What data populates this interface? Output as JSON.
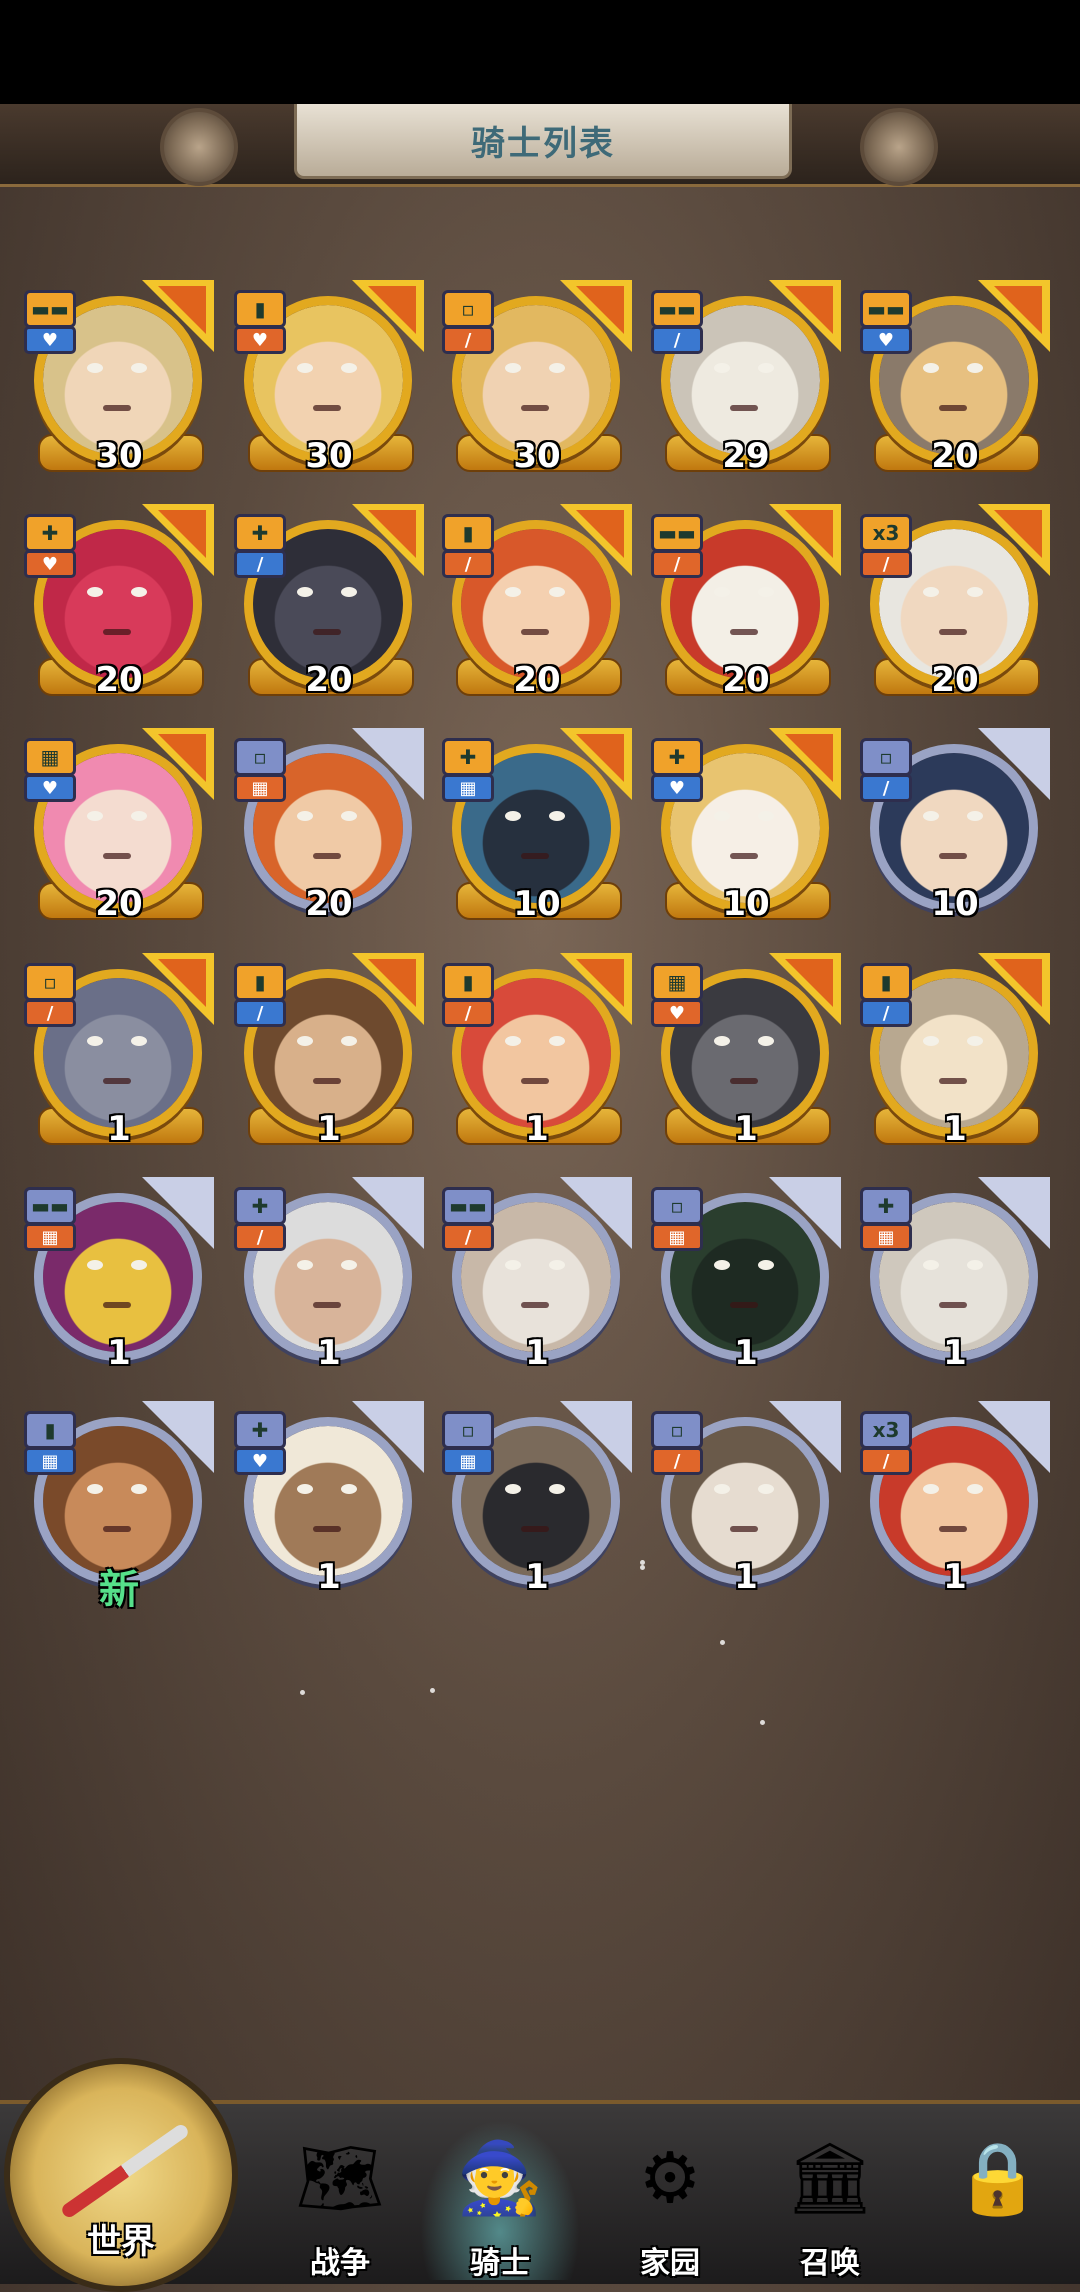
{
  "header": {
    "title": "骑士列表"
  },
  "heroes": [
    {
      "level": "30",
      "frame": "gold",
      "top": "▬▬",
      "bottom": "♥",
      "topColor": "#f0a22a",
      "bottomColor": "#3a78d0",
      "skin": "#f0d6b8",
      "hair": "#d8c28a"
    },
    {
      "level": "30",
      "frame": "gold",
      "top": "▮",
      "bottom": "♥",
      "topColor": "#f0a22a",
      "bottomColor": "#e0662a",
      "skin": "#f2d2b0",
      "hair": "#e8c460"
    },
    {
      "level": "30",
      "frame": "gold",
      "top": "▫",
      "bottom": "/",
      "topColor": "#f0a22a",
      "bottomColor": "#e0662a",
      "skin": "#f0d2b2",
      "hair": "#e2b860"
    },
    {
      "level": "29",
      "frame": "gold",
      "top": "▬▬",
      "bottom": "/",
      "topColor": "#f0a22a",
      "bottomColor": "#3a78d0",
      "skin": "#eeeae0",
      "hair": "#cbc4b8"
    },
    {
      "level": "20",
      "frame": "gold",
      "top": "▬▬",
      "bottom": "♥",
      "topColor": "#f0a22a",
      "bottomColor": "#3a78d0",
      "skin": "#e7c080",
      "hair": "#8a7a6a"
    },
    {
      "level": "20",
      "frame": "gold",
      "top": "✚",
      "bottom": "♥",
      "topColor": "#f0a22a",
      "bottomColor": "#e0662a",
      "skin": "#d83a5a",
      "hair": "#c02848"
    },
    {
      "level": "20",
      "frame": "gold",
      "top": "✚",
      "bottom": "/",
      "topColor": "#f0a22a",
      "bottomColor": "#3a78d0",
      "skin": "#4a4a58",
      "hair": "#2e2e38"
    },
    {
      "level": "20",
      "frame": "gold",
      "top": "▮",
      "bottom": "/",
      "topColor": "#f0a22a",
      "bottomColor": "#e0662a",
      "skin": "#f4d0b0",
      "hair": "#d8582a"
    },
    {
      "level": "20",
      "frame": "gold",
      "top": "▬▬",
      "bottom": "/",
      "topColor": "#f0a22a",
      "bottomColor": "#e0662a",
      "skin": "#f3efe6",
      "hair": "#c83a2a"
    },
    {
      "level": "20",
      "frame": "gold",
      "top": "x3",
      "bottom": "/",
      "topColor": "#f0a22a",
      "bottomColor": "#e0662a",
      "skin": "#f0d8c0",
      "hair": "#e8e6e0"
    },
    {
      "level": "20",
      "frame": "gold",
      "top": "▦",
      "bottom": "♥",
      "topColor": "#f0a22a",
      "bottomColor": "#3a78d0",
      "skin": "#f4dcd0",
      "hair": "#f08ab0"
    },
    {
      "level": "20",
      "frame": "silver",
      "top": "▫",
      "bottom": "▦",
      "topColor": "#7f8fc8",
      "bottomColor": "#e0662a",
      "skin": "#f0caa6",
      "hair": "#d8642a"
    },
    {
      "level": "10",
      "frame": "gold",
      "top": "✚",
      "bottom": "▦",
      "topColor": "#f0a22a",
      "bottomColor": "#3a78d0",
      "skin": "#26303e",
      "hair": "#3a6a8a"
    },
    {
      "level": "10",
      "frame": "gold",
      "top": "✚",
      "bottom": "♥",
      "topColor": "#f0a22a",
      "bottomColor": "#3a78d0",
      "skin": "#f6efe6",
      "hair": "#e8c470"
    },
    {
      "level": "10",
      "frame": "silver",
      "top": "▫",
      "bottom": "/",
      "topColor": "#7f8fc8",
      "bottomColor": "#3a78d0",
      "skin": "#f0d8c0",
      "hair": "#2c3a5a"
    },
    {
      "level": "1",
      "frame": "gold",
      "top": "▫",
      "bottom": "/",
      "topColor": "#f0a22a",
      "bottomColor": "#e0662a",
      "skin": "#8a8ea0",
      "hair": "#6a6f88"
    },
    {
      "level": "1",
      "frame": "gold",
      "top": "▮",
      "bottom": "/",
      "topColor": "#f0a22a",
      "bottomColor": "#3a78d0",
      "skin": "#d8b08a",
      "hair": "#6e4a2e"
    },
    {
      "level": "1",
      "frame": "gold",
      "top": "▮",
      "bottom": "/",
      "topColor": "#f0a22a",
      "bottomColor": "#e0662a",
      "skin": "#f2c6a0",
      "hair": "#d84a3a"
    },
    {
      "level": "1",
      "frame": "gold",
      "top": "▦",
      "bottom": "♥",
      "topColor": "#f0a22a",
      "bottomColor": "#e0662a",
      "skin": "#6a6a70",
      "hair": "#3a3a40"
    },
    {
      "level": "1",
      "frame": "gold",
      "top": "▮",
      "bottom": "/",
      "topColor": "#f0a22a",
      "bottomColor": "#3a78d0",
      "skin": "#f2e2c8",
      "hair": "#b8a890"
    },
    {
      "level": "1",
      "frame": "silver",
      "top": "▬▬",
      "bottom": "▦",
      "topColor": "#7f8fc8",
      "bottomColor": "#e0662a",
      "skin": "#e8c040",
      "hair": "#7a2a6a"
    },
    {
      "level": "1",
      "frame": "silver",
      "top": "✚",
      "bottom": "/",
      "topColor": "#7f8fc8",
      "bottomColor": "#e0662a",
      "skin": "#d8b49a",
      "hair": "#dcdcdc"
    },
    {
      "level": "1",
      "frame": "silver",
      "top": "▬▬",
      "bottom": "/",
      "topColor": "#7f8fc8",
      "bottomColor": "#e0662a",
      "skin": "#e8e2da",
      "hair": "#c8b8a8"
    },
    {
      "level": "1",
      "frame": "silver",
      "top": "▫",
      "bottom": "▦",
      "topColor": "#7f8fc8",
      "bottomColor": "#e0662a",
      "skin": "#1e2a22",
      "hair": "#2a3e2e"
    },
    {
      "level": "1",
      "frame": "silver",
      "top": "✚",
      "bottom": "▦",
      "topColor": "#7f8fc8",
      "bottomColor": "#e0662a",
      "skin": "#e6e2da",
      "hair": "#cfc8bd"
    },
    {
      "level": "新",
      "frame": "silver",
      "top": "▮",
      "bottom": "▦",
      "topColor": "#7f8fc8",
      "bottomColor": "#3a78d0",
      "skin": "#c88a5a",
      "hair": "#7a4a2a"
    },
    {
      "level": "1",
      "frame": "silver",
      "top": "✚",
      "bottom": "♥",
      "topColor": "#7f8fc8",
      "bottomColor": "#3a78d0",
      "skin": "#a07a58",
      "hair": "#f0e8d8"
    },
    {
      "level": "1",
      "frame": "silver",
      "top": "▫",
      "bottom": "▦",
      "topColor": "#7f8fc8",
      "bottomColor": "#3a78d0",
      "skin": "#2a2a2e",
      "hair": "#7a6a5a"
    },
    {
      "level": "1",
      "frame": "silver",
      "top": "▫",
      "bottom": "/",
      "topColor": "#7f8fc8",
      "bottomColor": "#e0662a",
      "skin": "#e6dcd0",
      "hair": "#6a5a4a"
    },
    {
      "level": "1",
      "frame": "silver",
      "top": "x3",
      "bottom": "/",
      "topColor": "#7f8fc8",
      "bottomColor": "#e0662a",
      "skin": "#f2c6a0",
      "hair": "#c83a2a"
    }
  ],
  "nav": {
    "world": "世界",
    "war": "战争",
    "knight": "骑士",
    "home": "家园",
    "summon": "召唤"
  }
}
